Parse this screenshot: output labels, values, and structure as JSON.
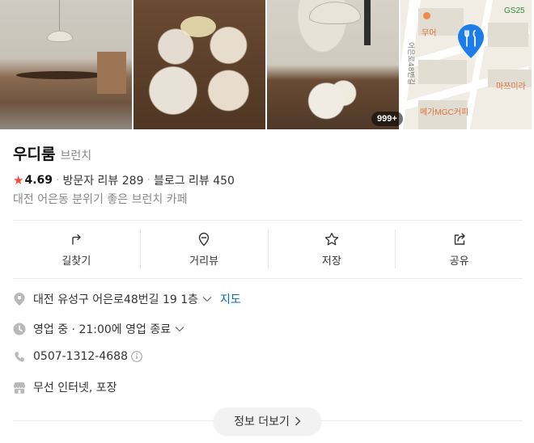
{
  "gallery": {
    "count_badge": "999+"
  },
  "map": {
    "poi_top_left": "무어",
    "poi_top_right": "GS25",
    "poi_right": "마쯔미라",
    "poi_bottom": "메가MGC커피",
    "road_label": "어은로48번길"
  },
  "place": {
    "name": "우디룸",
    "category": "브런치",
    "rating": "4.69",
    "visitor_reviews": "방문자 리뷰 289",
    "blog_reviews": "블로그 리뷰 450",
    "description": "대전 어은동 분위기 좋은 브런치 카페"
  },
  "actions": [
    {
      "label": "길찾기",
      "icon": "directions-icon"
    },
    {
      "label": "거리뷰",
      "icon": "street-view-icon"
    },
    {
      "label": "저장",
      "icon": "star-icon"
    },
    {
      "label": "공유",
      "icon": "share-icon"
    }
  ],
  "info": {
    "address": "대전 유성구 어은로48번길 19 1층",
    "map_link": "지도",
    "hours": "영업 중 · 21:00에 영업 종료",
    "phone": "0507-1312-4688",
    "amenities": "무선 인터넷, 포장"
  },
  "more_button": "정보 더보기",
  "colors": {
    "star": "#ff4436",
    "link": "#0068c3",
    "pin": "#1e7ce8"
  }
}
